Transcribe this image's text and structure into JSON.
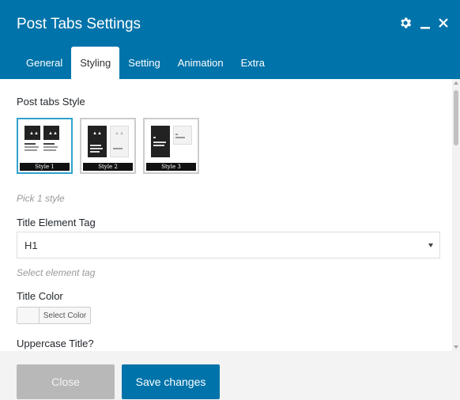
{
  "dialog": {
    "title": "Post Tabs Settings",
    "icons": [
      "gear-icon",
      "minimize-icon",
      "close-icon"
    ]
  },
  "tabs": [
    {
      "label": "General",
      "active": false
    },
    {
      "label": "Styling",
      "active": true
    },
    {
      "label": "Setting",
      "active": false
    },
    {
      "label": "Animation",
      "active": false
    },
    {
      "label": "Extra",
      "active": false
    }
  ],
  "post_tabs_style": {
    "label": "Post tabs Style",
    "options": [
      {
        "caption": "Style 1",
        "selected": true
      },
      {
        "caption": "Style 2",
        "selected": false
      },
      {
        "caption": "Style 3",
        "selected": false
      }
    ],
    "hint": "Pick 1 style"
  },
  "title_element_tag": {
    "label": "Title Element Tag",
    "value": "H1",
    "hint": "Select element tag"
  },
  "title_color": {
    "label": "Title Color",
    "button_label": "Select Color"
  },
  "uppercase_title": {
    "label": "Uppercase Title?"
  },
  "footer": {
    "close_label": "Close",
    "save_label": "Save changes"
  },
  "colors": {
    "header_bg": "#0073aa",
    "selected_border": "#2ea2cc",
    "close_bg": "#b8b8b8",
    "save_bg": "#0073aa"
  }
}
